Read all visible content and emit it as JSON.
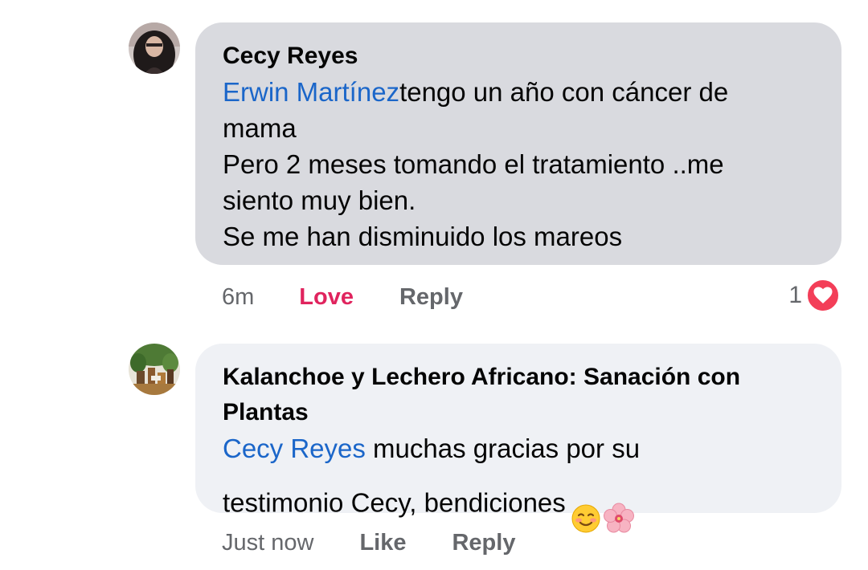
{
  "comments": [
    {
      "author": "Cecy Reyes",
      "mention": "Erwin Martínez",
      "lines": [
        "tengo un año con cáncer de",
        "mama",
        "Pero 2 meses tomando el tratamiento ..me",
        "siento muy bien.",
        "Se me han disminuido los mareos"
      ],
      "time": "6m",
      "reaction_label": "Love",
      "reply_label": "Reply",
      "reaction_count": "1",
      "reaction_icon": "heart-icon"
    },
    {
      "author_line1": "Kalanchoe y  Lechero Africano: Sanación con",
      "author_line2": "Plantas",
      "mention": "Cecy Reyes",
      "line1": " muchas gracias por su",
      "line2": "testimonio Cecy, bendiciones",
      "emojis": [
        "smiling-face-icon",
        "flower-icon"
      ],
      "time": "Just now",
      "like_label": "Like",
      "reply_label": "Reply"
    }
  ],
  "colors": {
    "mention": "#1b66c9",
    "love": "#e0245e",
    "bubble_1": "#d9dadf",
    "bubble_2": "#eff1f5",
    "meta": "#65676b"
  }
}
